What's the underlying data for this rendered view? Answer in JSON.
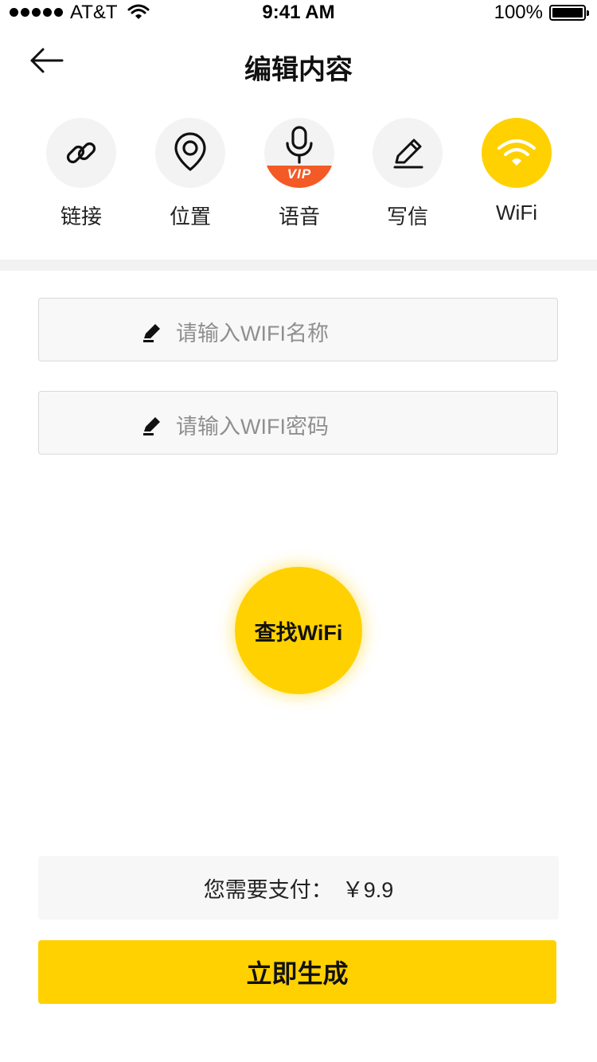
{
  "status_bar": {
    "carrier": "AT&T",
    "time": "9:41 AM",
    "battery": "100%",
    "icons": [
      "signal-dots-icon",
      "wifi-icon",
      "battery-icon"
    ]
  },
  "header": {
    "title": "编辑内容",
    "back_icon": "arrow-left-icon"
  },
  "tabs": [
    {
      "label": "链接",
      "icon": "link-icon",
      "active": false
    },
    {
      "label": "位置",
      "icon": "location-pin-icon",
      "active": false
    },
    {
      "label": "语音",
      "icon": "microphone-icon",
      "badge": "VIP",
      "active": false
    },
    {
      "label": "写信",
      "icon": "pencil-icon",
      "active": false
    },
    {
      "label": "WiFi",
      "icon": "wifi-icon",
      "active": true
    }
  ],
  "form": {
    "wifi_name_placeholder": "请输入WIFI名称",
    "wifi_password_placeholder": "请输入WIFI密码",
    "field_icon": "pencil-icon"
  },
  "find_button": {
    "label": "查找WiFi"
  },
  "payment": {
    "label": "您需要支付：",
    "amount": "￥9.9"
  },
  "generate_button": {
    "label": "立即生成"
  },
  "colors": {
    "accent": "#ffd100",
    "vip_badge": "#f35a26",
    "icon_bg": "#f3f3f3"
  }
}
